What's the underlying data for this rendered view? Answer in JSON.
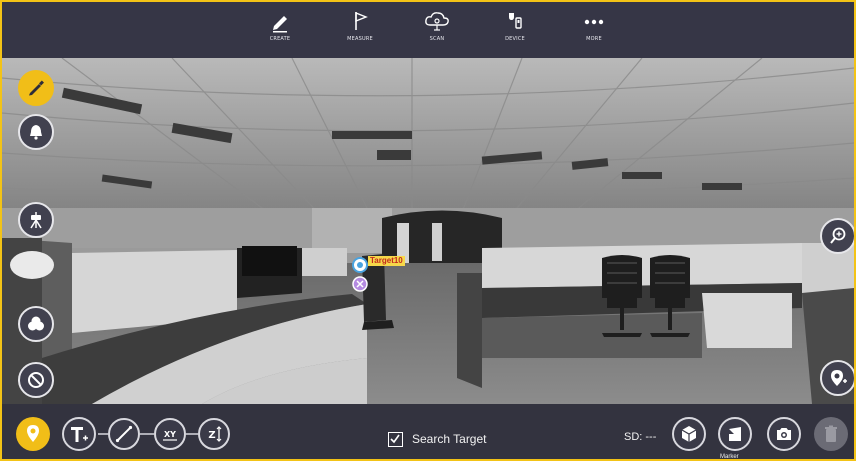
{
  "toolbar": {
    "tools": [
      {
        "label": "CREATE",
        "icon": "pencil-icon"
      },
      {
        "label": "MEASURE",
        "icon": "flag-icon"
      },
      {
        "label": "SCAN",
        "icon": "cloud-scan-icon"
      },
      {
        "label": "DEVICE",
        "icon": "device-icon"
      },
      {
        "label": "MORE",
        "icon": "more-icon"
      }
    ]
  },
  "scene": {
    "target_label": "Target10"
  },
  "bottombar": {
    "search_target_label": "Search Target",
    "search_target_checked": true,
    "sd_label": "SD: ---",
    "marker_label": "Marker"
  },
  "colors": {
    "accent": "#f1be18",
    "toolbar_bg": "#363646",
    "button_border": "#e6e6ea"
  }
}
